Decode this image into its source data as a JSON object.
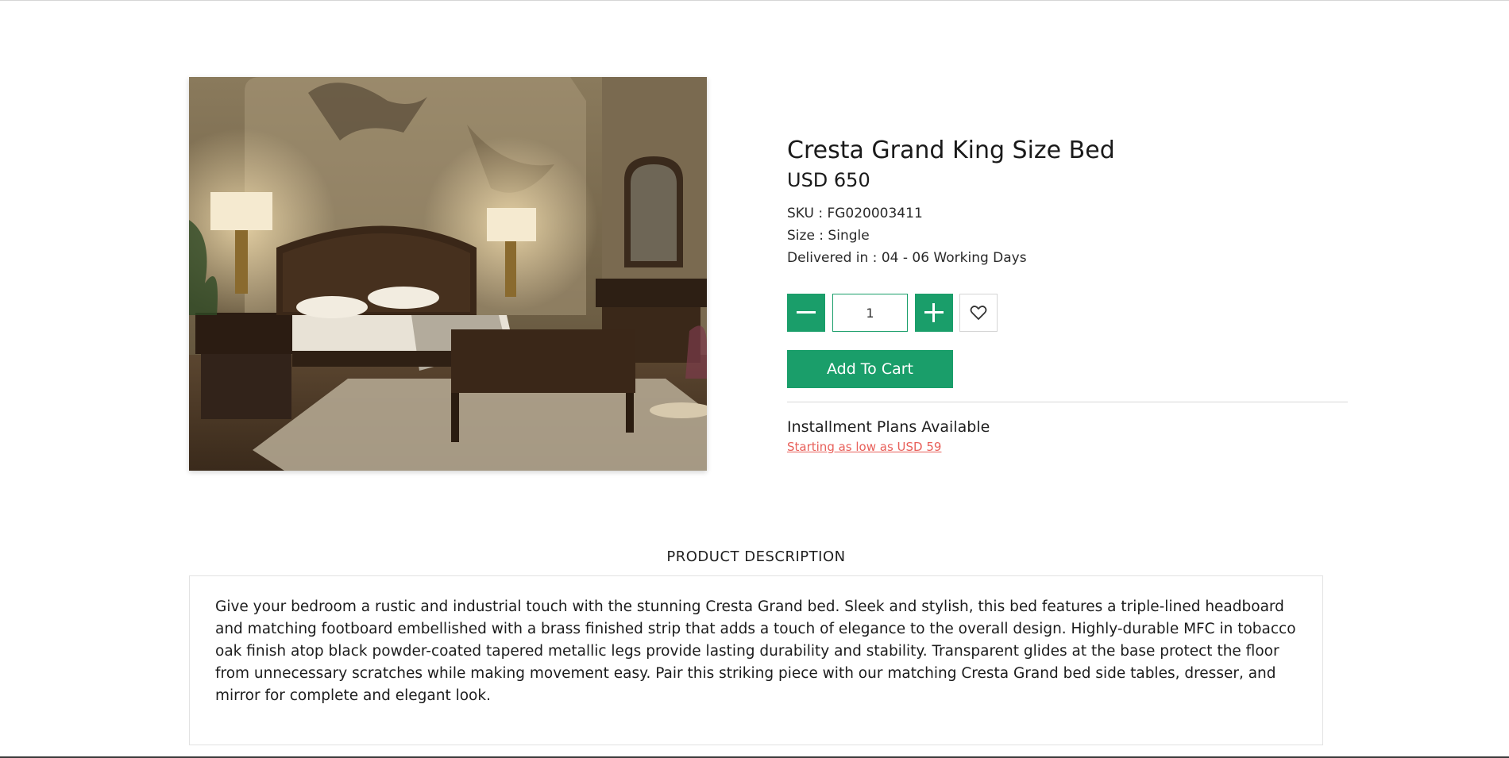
{
  "product": {
    "image_alt": "Cresta Grand King Size Bed",
    "title": "Cresta Grand King Size Bed",
    "price": "USD 650",
    "sku": "SKU : FG020003411",
    "size": "Size : Single",
    "delivery": "Delivered in : 04 - 06 Working Days"
  },
  "quantity": {
    "value": "1",
    "minus_icon": "minus-icon",
    "plus_icon": "plus-icon",
    "wishlist_icon": "heart-icon"
  },
  "cart": {
    "add_label": "Add To Cart"
  },
  "installments": {
    "title": "Installment Plans Available",
    "link": "Starting as low as USD 59"
  },
  "description": {
    "heading": "PRODUCT DESCRIPTION",
    "text": "Give your bedroom a rustic and industrial touch with the stunning Cresta Grand bed. Sleek and stylish, this bed features a triple-lined headboard and matching footboard embellished with a brass finished strip that adds a touch of elegance to the overall design. Highly-durable MFC in tobacco oak finish atop black powder-coated tapered metallic legs provide lasting durability and stability. Transparent glides at the base protect the floor from unnecessary scratches while making movement easy. Pair this striking piece with our matching Cresta Grand bed side tables, dresser, and mirror for complete and elegant look."
  },
  "colors": {
    "accent": "#1a9e6a",
    "link": "#e8605a"
  }
}
